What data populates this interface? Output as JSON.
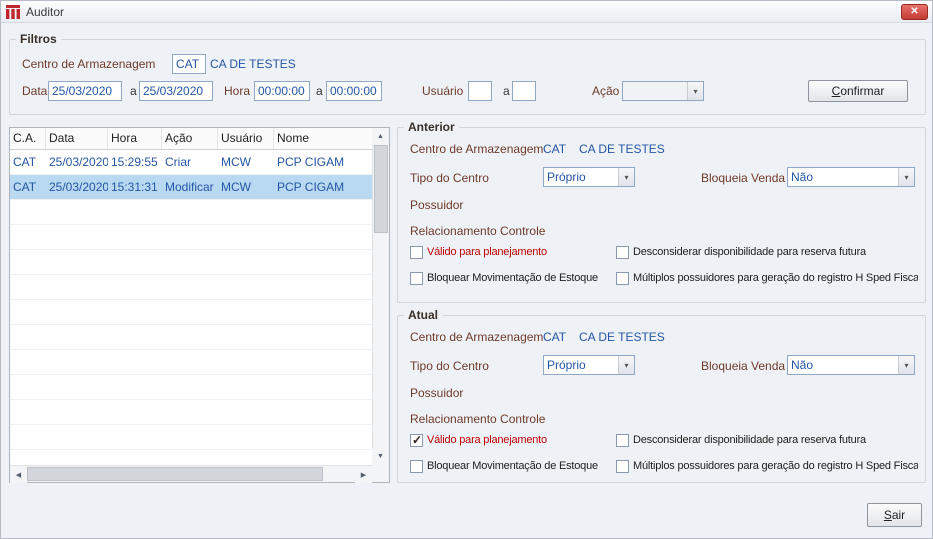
{
  "window": {
    "title": "Auditor"
  },
  "icons": {
    "close": "✕",
    "combo_arrow": "▾",
    "scroll_up": "▲",
    "scroll_down": "▼",
    "scroll_left": "◀",
    "scroll_right": "▶"
  },
  "colors": {
    "accent_red": "#c0272d",
    "value_blue": "#2456a4",
    "label_maroon": "#6e3a28",
    "selection_blue": "#b9d8f2",
    "alert_red": "#c00000"
  },
  "filters": {
    "title": "Filtros",
    "centro_label": "Centro de Armazenagem",
    "centro_value": "CAT",
    "centro_desc": "CA DE TESTES",
    "data_label": "Data",
    "range_sep": "a",
    "data_from": "25/03/2020",
    "data_to": "25/03/2020",
    "hora_label": "Hora",
    "hora_from": "00:00:00",
    "hora_to": "00:00:00",
    "usuario_label": "Usuário",
    "usuario_from": "",
    "usuario_to": "",
    "acao_label": "Ação",
    "acao_value": "",
    "confirm_label": "Confirmar"
  },
  "grid": {
    "columns": [
      "C.A.",
      "Data",
      "Hora",
      "Ação",
      "Usuário",
      "Nome"
    ],
    "rows": [
      {
        "ca": "CAT",
        "data": "25/03/2020",
        "hora": "15:29:55",
        "acao": "Criar",
        "usuario": "MCW",
        "nome": "PCP CIGAM"
      },
      {
        "ca": "CAT",
        "data": "25/03/2020",
        "hora": "15:31:31",
        "acao": "Modificar",
        "usuario": "MCW",
        "nome": "PCP CIGAM"
      }
    ],
    "selected_row": 1
  },
  "panels": [
    {
      "title": "Anterior",
      "centro_label": "Centro de Armazenagem",
      "centro_value": "CAT",
      "centro_desc": "CA DE TESTES",
      "tipo_label": "Tipo do Centro",
      "tipo_value": "Próprio",
      "bloqueia_label": "Bloqueia Venda",
      "bloqueia_value": "Não",
      "possuidor_label": "Possuidor",
      "relacionamento_label": "Relacionamento Controle",
      "checkboxes": [
        {
          "label": "Válido para planejamento",
          "checked": false
        },
        {
          "label": "Desconsiderar disponibilidade para reserva futura",
          "checked": false
        },
        {
          "label": "Bloquear Movimentação de Estoque",
          "checked": false
        },
        {
          "label": "Múltiplos possuidores para geração do registro H Sped Fiscal",
          "checked": false
        }
      ]
    },
    {
      "title": "Atual",
      "centro_label": "Centro de Armazenagem",
      "centro_value": "CAT",
      "centro_desc": "CA DE TESTES",
      "tipo_label": "Tipo do Centro",
      "tipo_value": "Próprio",
      "bloqueia_label": "Bloqueia Venda",
      "bloqueia_value": "Não",
      "possuidor_label": "Possuidor",
      "relacionamento_label": "Relacionamento Controle",
      "checkboxes": [
        {
          "label": "Válido para planejamento",
          "checked": true
        },
        {
          "label": "Desconsiderar disponibilidade para reserva futura",
          "checked": false
        },
        {
          "label": "Bloquear Movimentação de Estoque",
          "checked": false
        },
        {
          "label": "Múltiplos possuidores para geração do registro H Sped Fiscal",
          "checked": false
        }
      ]
    }
  ],
  "footer": {
    "sair_label": "Sair"
  }
}
